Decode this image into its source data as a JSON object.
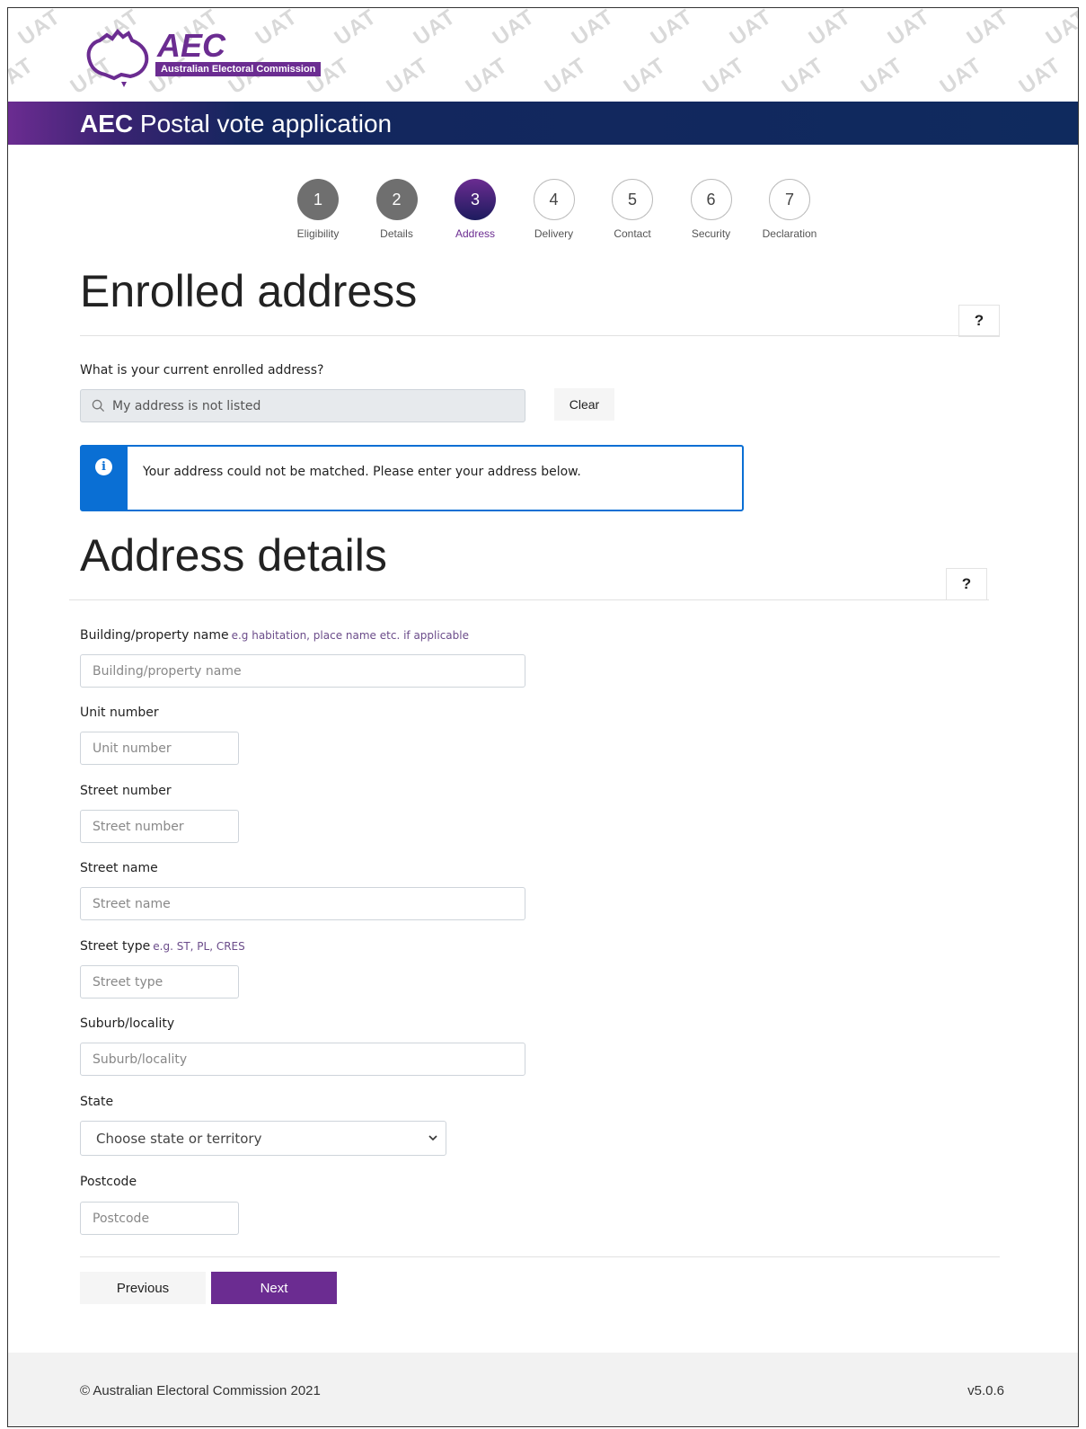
{
  "header": {
    "logo_name": "AEC",
    "logo_subtitle": "Australian Electoral Commission",
    "watermark": "UAT",
    "title_bold": "AEC",
    "title_rest": " Postal vote application"
  },
  "stepper": {
    "steps": [
      {
        "number": "1",
        "label": "Eligibility",
        "state": "done"
      },
      {
        "number": "2",
        "label": "Details",
        "state": "done"
      },
      {
        "number": "3",
        "label": "Address",
        "state": "current"
      },
      {
        "number": "4",
        "label": "Delivery",
        "state": "todo"
      },
      {
        "number": "5",
        "label": "Contact",
        "state": "todo"
      },
      {
        "number": "6",
        "label": "Security",
        "state": "todo"
      },
      {
        "number": "7",
        "label": "Declaration",
        "state": "todo"
      }
    ]
  },
  "enrolled": {
    "heading": "Enrolled address",
    "help_label": "?",
    "question": "What is your current enrolled address?",
    "search_value": "My address is not listed",
    "clear_label": "Clear",
    "alert_message": "Your address could not be matched. Please enter your address below."
  },
  "details": {
    "heading": "Address details",
    "help_label": "?",
    "building": {
      "label": "Building/property name",
      "hint": "e.g habitation, place name etc. if applicable",
      "placeholder": "Building/property name"
    },
    "unit": {
      "label": "Unit number",
      "placeholder": "Unit number"
    },
    "street_number": {
      "label": "Street number",
      "placeholder": "Street number"
    },
    "street_name": {
      "label": "Street name",
      "placeholder": "Street name"
    },
    "street_type": {
      "label": "Street type",
      "hint": "e.g. ST, PL, CRES",
      "placeholder": "Street type"
    },
    "suburb": {
      "label": "Suburb/locality",
      "placeholder": "Suburb/locality"
    },
    "state": {
      "label": "State",
      "selected": "Choose state or territory"
    },
    "postcode": {
      "label": "Postcode",
      "placeholder": "Postcode"
    }
  },
  "nav": {
    "previous_label": "Previous",
    "next_label": "Next"
  },
  "footer": {
    "copyright": "© Australian Electoral Commission 2021",
    "version": "v5.0.6"
  },
  "colors": {
    "brand_purple": "#6b2c91",
    "navy": "#0f2a5e",
    "info_blue": "#0a6fd4"
  }
}
